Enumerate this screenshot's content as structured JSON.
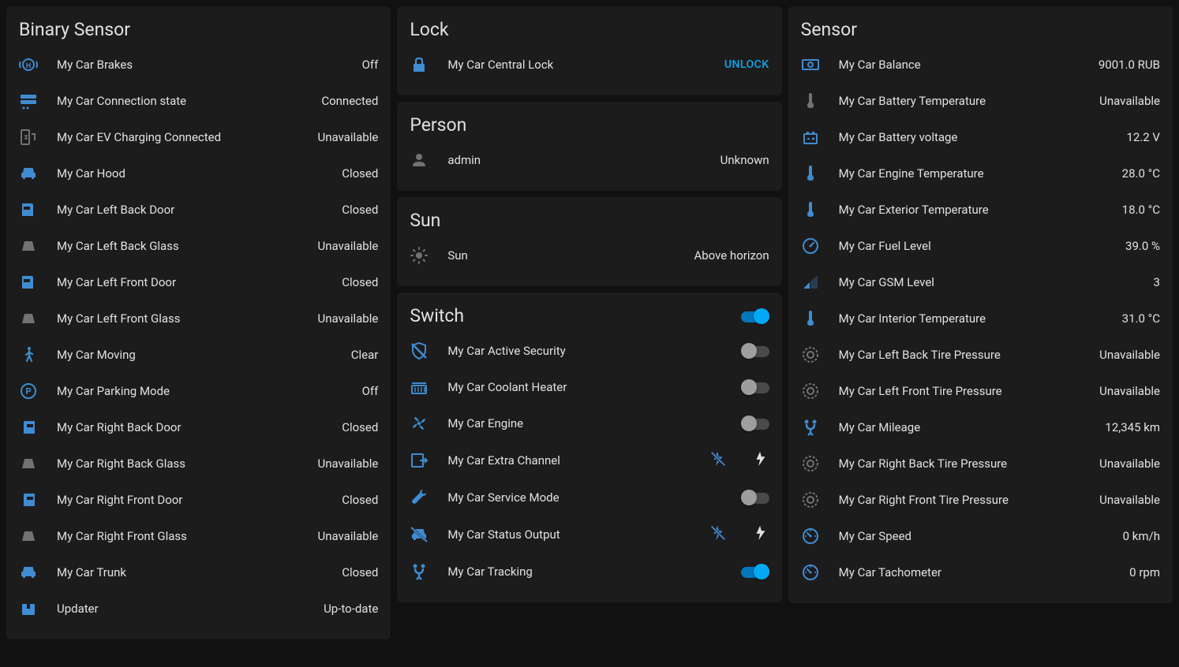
{
  "binarySensor": {
    "title": "Binary Sensor",
    "items": [
      {
        "icon": "brakes",
        "iconColor": "blue",
        "label": "My Car Brakes",
        "value": "Off"
      },
      {
        "icon": "connection",
        "iconColor": "blue",
        "label": "My Car Connection state",
        "value": "Connected"
      },
      {
        "icon": "ev",
        "iconColor": "gray",
        "label": "My Car EV Charging Connected",
        "value": "Unavailable"
      },
      {
        "icon": "car",
        "iconColor": "blue",
        "label": "My Car Hood",
        "value": "Closed"
      },
      {
        "icon": "door-left",
        "iconColor": "blue",
        "label": "My Car Left Back Door",
        "value": "Closed"
      },
      {
        "icon": "glass",
        "iconColor": "gray",
        "label": "My Car Left Back Glass",
        "value": "Unavailable"
      },
      {
        "icon": "door-left",
        "iconColor": "blue",
        "label": "My Car Left Front Door",
        "value": "Closed"
      },
      {
        "icon": "glass",
        "iconColor": "gray",
        "label": "My Car Left Front Glass",
        "value": "Unavailable"
      },
      {
        "icon": "walk",
        "iconColor": "blue",
        "label": "My Car Moving",
        "value": "Clear"
      },
      {
        "icon": "parking",
        "iconColor": "blue",
        "label": "My Car Parking Mode",
        "value": "Off"
      },
      {
        "icon": "door-right",
        "iconColor": "blue",
        "label": "My Car Right Back Door",
        "value": "Closed"
      },
      {
        "icon": "glass",
        "iconColor": "gray",
        "label": "My Car Right Back Glass",
        "value": "Unavailable"
      },
      {
        "icon": "door-right",
        "iconColor": "blue",
        "label": "My Car Right Front Door",
        "value": "Closed"
      },
      {
        "icon": "glass",
        "iconColor": "gray",
        "label": "My Car Right Front Glass",
        "value": "Unavailable"
      },
      {
        "icon": "car",
        "iconColor": "blue",
        "label": "My Car Trunk",
        "value": "Closed"
      },
      {
        "icon": "package",
        "iconColor": "blue",
        "label": "Updater",
        "value": "Up-to-date"
      }
    ]
  },
  "lock": {
    "title": "Lock",
    "items": [
      {
        "icon": "lock",
        "iconColor": "blue",
        "label": "My Car Central Lock",
        "action": "UNLOCK"
      }
    ]
  },
  "person": {
    "title": "Person",
    "items": [
      {
        "icon": "person",
        "iconColor": "gray",
        "label": "admin",
        "value": "Unknown"
      }
    ]
  },
  "sun": {
    "title": "Sun",
    "items": [
      {
        "icon": "sun",
        "iconColor": "gray",
        "label": "Sun",
        "value": "Above horizon"
      }
    ]
  },
  "switch": {
    "title": "Switch",
    "headerToggle": true,
    "items": [
      {
        "icon": "shield-off",
        "iconColor": "blue",
        "label": "My Car Active Security",
        "control": "toggle",
        "on": false
      },
      {
        "icon": "radiator",
        "iconColor": "blue",
        "label": "My Car Coolant Heater",
        "control": "toggle",
        "on": false
      },
      {
        "icon": "fan",
        "iconColor": "blue",
        "label": "My Car Engine",
        "control": "toggle",
        "on": false
      },
      {
        "icon": "export",
        "iconColor": "blue",
        "label": "My Car Extra Channel",
        "control": "flash"
      },
      {
        "icon": "wrench",
        "iconColor": "blue",
        "label": "My Car Service Mode",
        "control": "toggle",
        "on": false
      },
      {
        "icon": "car-off",
        "iconColor": "blue",
        "label": "My Car Status Output",
        "control": "flash"
      },
      {
        "icon": "gps",
        "iconColor": "blue",
        "label": "My Car Tracking",
        "control": "toggle",
        "on": true
      }
    ]
  },
  "sensor": {
    "title": "Sensor",
    "items": [
      {
        "icon": "cash",
        "iconColor": "blue",
        "label": "My Car Balance",
        "value": "9001.0 RUB"
      },
      {
        "icon": "thermometer",
        "iconColor": "gray",
        "label": "My Car Battery Temperature",
        "value": "Unavailable"
      },
      {
        "icon": "battery",
        "iconColor": "blue",
        "label": "My Car Battery voltage",
        "value": "12.2 V"
      },
      {
        "icon": "thermometer",
        "iconColor": "blue",
        "label": "My Car Engine Temperature",
        "value": "28.0 °C"
      },
      {
        "icon": "thermometer",
        "iconColor": "blue",
        "label": "My Car Exterior Temperature",
        "value": "18.0 °C"
      },
      {
        "icon": "gauge",
        "iconColor": "blue",
        "label": "My Car Fuel Level",
        "value": "39.0 %"
      },
      {
        "icon": "signal",
        "iconColor": "blue",
        "label": "My Car GSM Level",
        "value": "3"
      },
      {
        "icon": "thermometer",
        "iconColor": "blue",
        "label": "My Car Interior Temperature",
        "value": "31.0 °C"
      },
      {
        "icon": "tire",
        "iconColor": "gray",
        "label": "My Car Left Back Tire Pressure",
        "value": "Unavailable"
      },
      {
        "icon": "tire",
        "iconColor": "gray",
        "label": "My Car Left Front Tire Pressure",
        "value": "Unavailable"
      },
      {
        "icon": "gps",
        "iconColor": "blue",
        "label": "My Car Mileage",
        "value": "12,345 km"
      },
      {
        "icon": "tire",
        "iconColor": "gray",
        "label": "My Car Right Back Tire Pressure",
        "value": "Unavailable"
      },
      {
        "icon": "tire",
        "iconColor": "gray",
        "label": "My Car Right Front Tire Pressure",
        "value": "Unavailable"
      },
      {
        "icon": "speed",
        "iconColor": "blue",
        "label": "My Car Speed",
        "value": "0 km/h"
      },
      {
        "icon": "speed",
        "iconColor": "blue",
        "label": "My Car Tachometer",
        "value": "0 rpm"
      }
    ]
  }
}
